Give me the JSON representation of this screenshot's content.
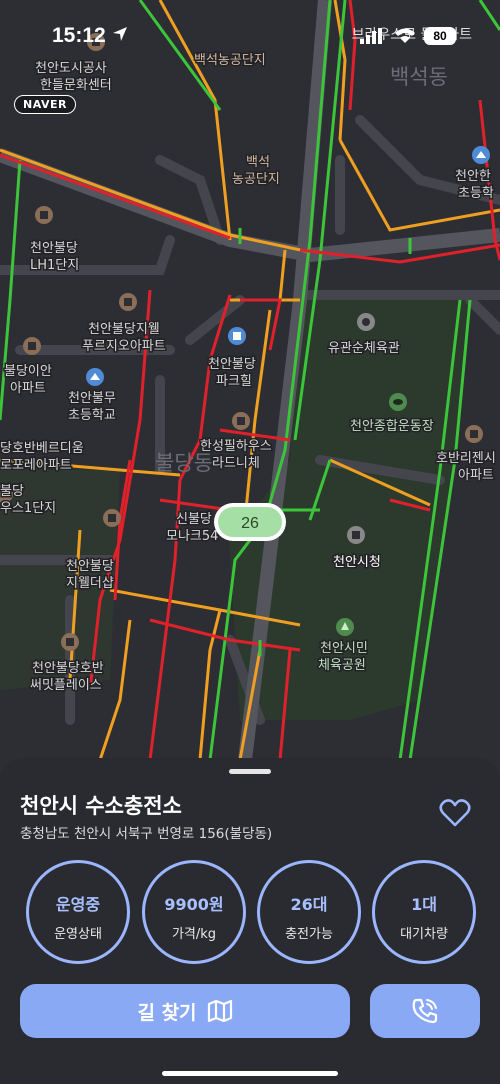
{
  "status_bar": {
    "time": "15:12",
    "carrier": "브라우스로 돌아가트",
    "battery": "80"
  },
  "map": {
    "provider_logo": "NAVER",
    "station_marker_count": "26",
    "labels": {
      "culture_center": "천안도시공사 한들문화센터",
      "complex_top": "백석농공단지",
      "complex_side": "백석 농공단지",
      "dong_baekseok": "백석동",
      "lh1": "천안불당 LH1단지",
      "jiwell": "천안불당지웰 푸르지오아파트",
      "parkhill": "천안불당 파크힐",
      "gymnasium": "유관순체육관",
      "elem_right": "천안한 초등학",
      "bul_ian": "불당이안 아파트",
      "bul_elem": "천안불무 초등학교",
      "bul_berdium": "당호반베르디움 로포레아파트",
      "hanseong": "한성필하우스 라드니체",
      "sports_complex": "천안종합운동장",
      "hobanri": "호반리젠시 아파트",
      "bul1": "불당 우스1단지",
      "dong_buldang": "불당동",
      "shinbul": "신불당 모나크54",
      "jiwell_shop": "천안불당 지웰더샵",
      "city_hall": "천안시청",
      "hoban_place": "천안불당호반 써밋플레이스",
      "citizen_park": "천안시민 체육공원"
    },
    "icons": [
      "building-icon",
      "school-icon",
      "stadium-icon",
      "park-icon",
      "gymnasium-icon"
    ]
  },
  "station": {
    "name": "천안시 수소충전소",
    "address": "충청남도 천안시 서북구 번영로 156(불당동)",
    "stats": [
      {
        "value": "운영중",
        "label": "운영상태"
      },
      {
        "value": "9900원",
        "label": "가격/kg"
      },
      {
        "value": "26대",
        "label": "충전가능"
      },
      {
        "value": "1대",
        "label": "대기차량"
      }
    ],
    "route_button": "길 찾기"
  },
  "colors": {
    "accent": "#8aa9f5",
    "stat_ring": "#9bb5ff",
    "traffic_red": "#e0212b",
    "traffic_orange": "#f0a020",
    "traffic_green": "#3cc43a",
    "marker_green": "#a6dfa6"
  }
}
